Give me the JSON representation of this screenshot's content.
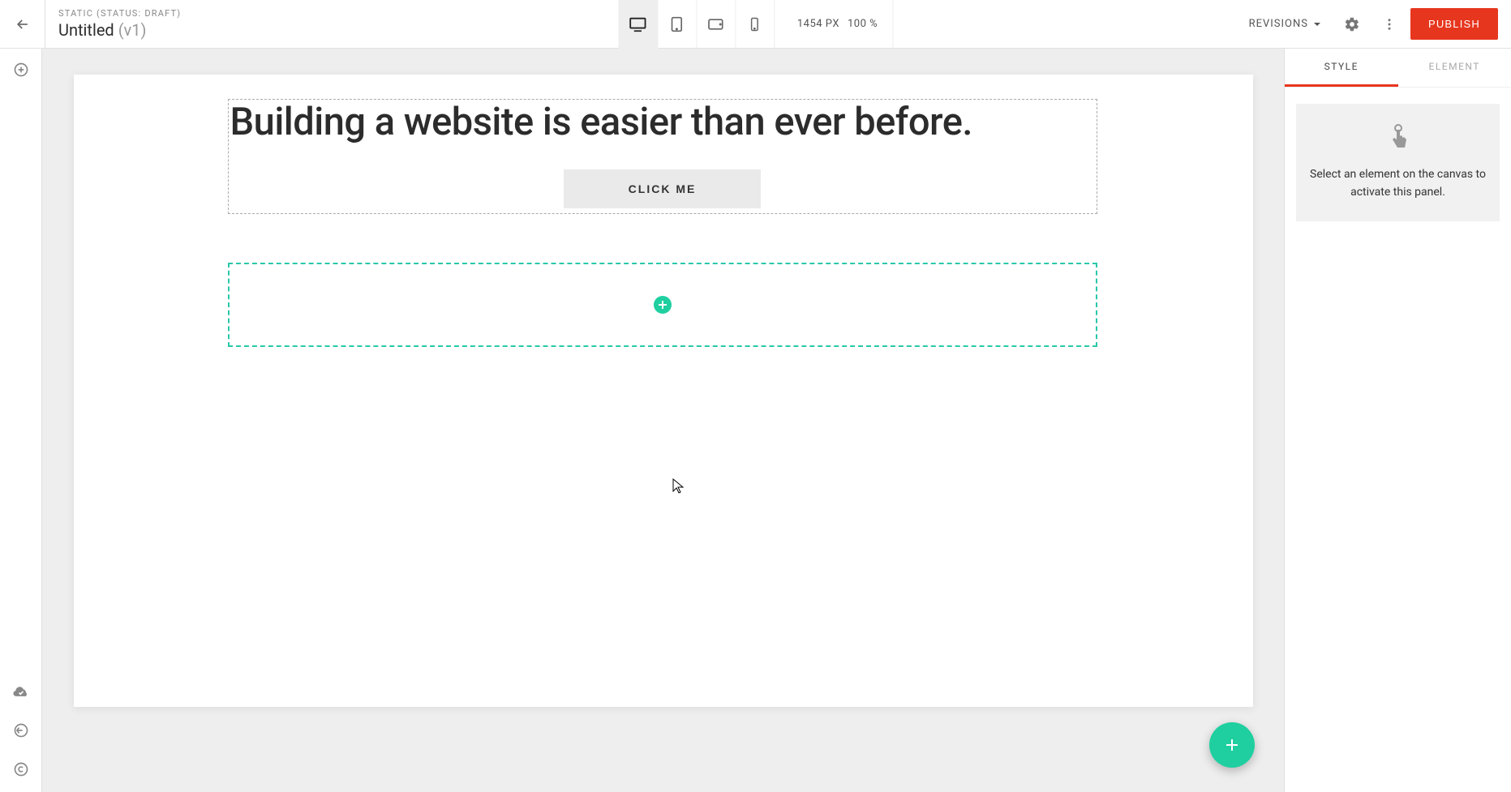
{
  "header": {
    "status_line": "STATIC (STATUS: DRAFT)",
    "title": "Untitled",
    "version": "(v1)",
    "revisions_label": "REVISIONS",
    "publish_label": "PUBLISH",
    "canvas_width": "1454 PX",
    "zoom": "100 %"
  },
  "canvas": {
    "headline": "Building a website is easier than ever before.",
    "cta_label": "CLICK ME"
  },
  "right_panel": {
    "tabs": {
      "style": "STYLE",
      "element": "ELEMENT"
    },
    "placeholder": "Select an element on the canvas to activate this panel."
  },
  "colors": {
    "accent_red": "#e7361e",
    "accent_teal": "#1fcfa0"
  }
}
